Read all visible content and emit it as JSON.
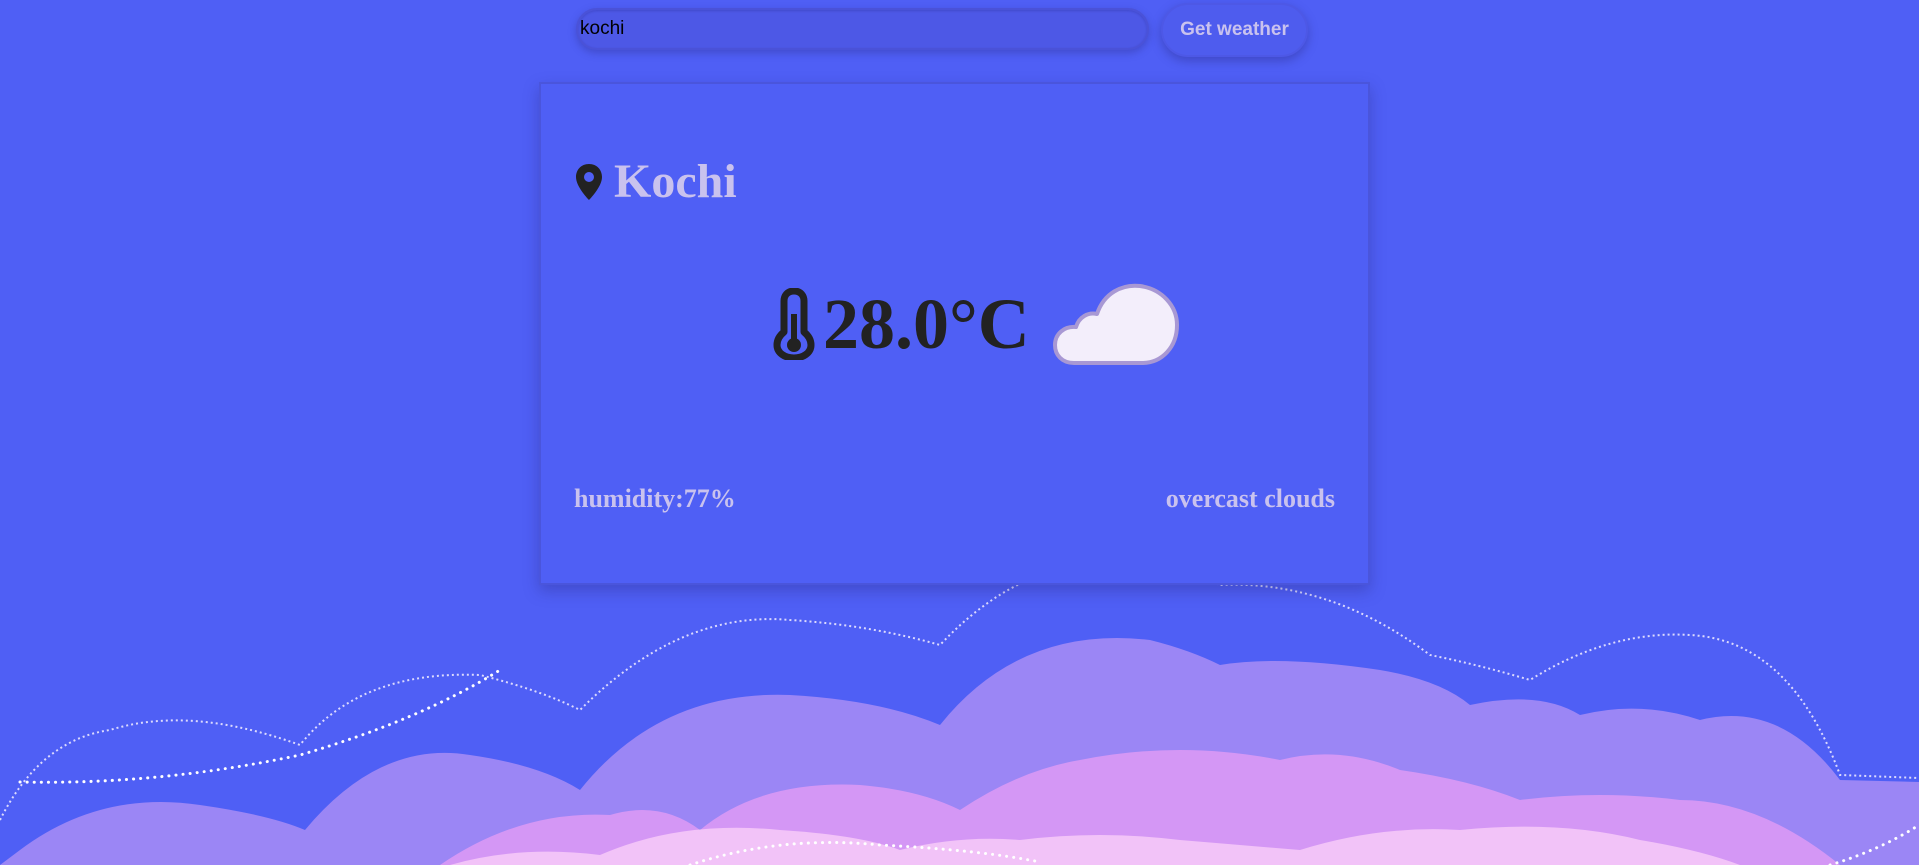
{
  "search": {
    "value": "kochi",
    "button_label": "Get weather"
  },
  "weather": {
    "city": "Kochi",
    "temperature": "28.0°C",
    "humidity": "humidity:77%",
    "description": "overcast clouds",
    "location_icon": "map-pin-icon",
    "temperature_icon": "thermometer-icon",
    "condition_icon": "cloud-icon"
  },
  "colors": {
    "background": "#4f5ff5",
    "card_text": "#c9c2ee",
    "temperature_text": "#222222",
    "cloud_back": "#9b86f5",
    "cloud_mid": "#d497f5",
    "cloud_front": "#f2c3f8"
  }
}
